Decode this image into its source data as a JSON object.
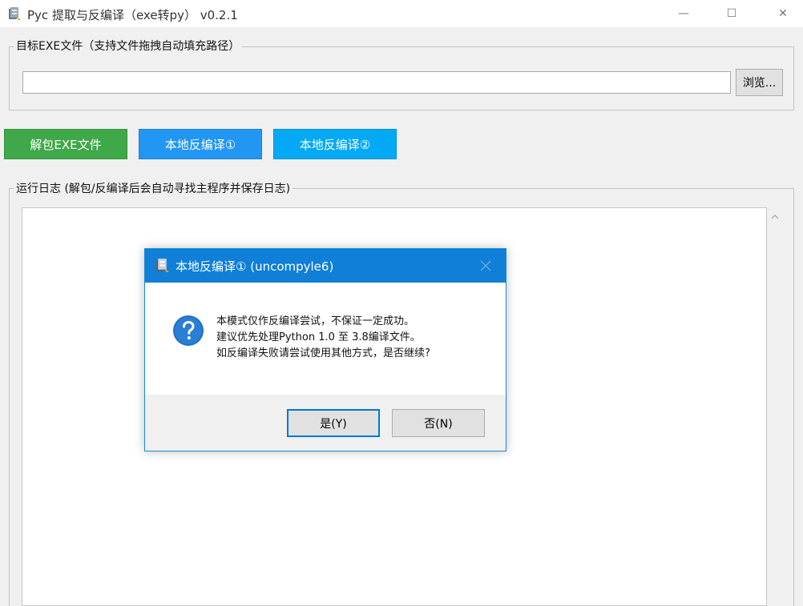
{
  "window": {
    "title": "Pyc 提取与反编译（exe转py） v0.2.1",
    "app_icon": "app-icon",
    "controls": {
      "minimize": "—",
      "maximize": "☐",
      "close": "✕"
    }
  },
  "target_group": {
    "label": "目标EXE文件（支持文件拖拽自动填充路径）",
    "path_value": "",
    "browse_label": "浏览..."
  },
  "actions": {
    "unpack_label": "解包EXE文件",
    "local1_label": "本地反编译①",
    "local2_label": "本地反编译②",
    "colors": {
      "unpack": "#3fa848",
      "local1": "#2196f3",
      "local2": "#03a9f4"
    }
  },
  "log_group": {
    "label": "运行日志 (解包/反编译后会自动寻找主程序并保存日志)",
    "content": ""
  },
  "dialog": {
    "title": "本地反编译① (uncompyle6)",
    "icon": "question-icon",
    "lines": [
      "本模式仅作反编译尝试，不保证一定成功。",
      "建议优先处理Python 1.0 至 3.8编译文件。",
      "如反编译失败请尝试使用其他方式，是否继续?"
    ],
    "yes_label": "是(Y)",
    "no_label": "否(N)",
    "accent": "#0f7fd8"
  }
}
